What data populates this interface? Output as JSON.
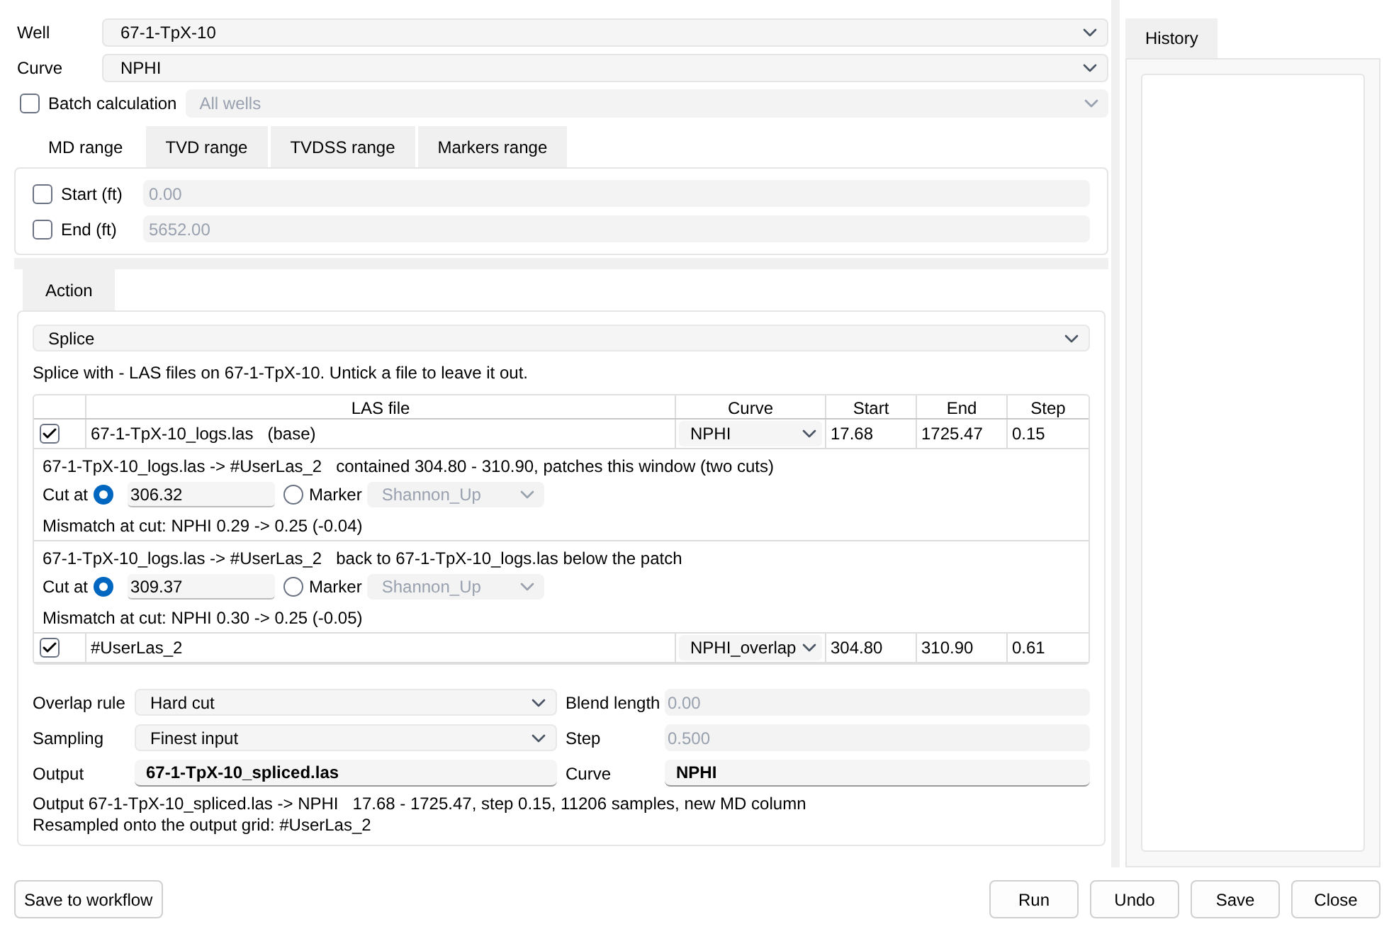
{
  "well": {
    "label": "Well",
    "value": "67-1-TpX-10"
  },
  "curve": {
    "label": "Curve",
    "value": "NPHI"
  },
  "batch": {
    "label": "Batch calculation",
    "checked": false,
    "value": "All wells"
  },
  "range_tabs": [
    {
      "label": "MD range",
      "selected": true
    },
    {
      "label": "TVD range",
      "selected": false
    },
    {
      "label": "TVDSS range",
      "selected": false
    },
    {
      "label": "Markers range",
      "selected": false
    }
  ],
  "range_fields": [
    {
      "label": "Start (ft)",
      "checked": false,
      "value": "0.00"
    },
    {
      "label": "End (ft)",
      "checked": false,
      "value": "5652.00"
    }
  ],
  "action_tab": {
    "label": "Action",
    "selected": true
  },
  "action": {
    "value": "Splice"
  },
  "info": "Splice with - LAS files on 67-1-TpX-10. Untick a file to leave it out.",
  "table": {
    "columns": [
      "LAS file",
      "Curve",
      "Start",
      "End",
      "Step"
    ],
    "rows": [
      {
        "kind": "file",
        "checked": true,
        "file": "67-1-TpX-10_logs.las   (base)",
        "curve": "NPHI",
        "start": "17.68",
        "end": "1725.47",
        "step": "0.15"
      },
      {
        "kind": "cut",
        "description": "67-1-TpX-10_logs.las -> #UserLas_2   contained 304.80 - 310.90, patches this window (two cuts)",
        "cut_label": "Cut at",
        "md_selected": true,
        "md_value": "306.32",
        "marker_selected": false,
        "marker_label": "Marker",
        "marker_value": "Shannon_Up",
        "mismatch": "Mismatch at cut: NPHI 0.29 -> 0.25 (-0.04)"
      },
      {
        "kind": "cut",
        "description": "67-1-TpX-10_logs.las -> #UserLas_2   back to 67-1-TpX-10_logs.las below the patch",
        "cut_label": "Cut at",
        "md_selected": true,
        "md_value": "309.37",
        "marker_selected": false,
        "marker_label": "Marker",
        "marker_value": "Shannon_Up",
        "mismatch": "Mismatch at cut: NPHI 0.30 -> 0.25 (-0.05)"
      },
      {
        "kind": "file",
        "checked": true,
        "file": "#UserLas_2",
        "curve": "NPHI_overlap",
        "start": "304.80",
        "end": "310.90",
        "step": "0.61"
      }
    ]
  },
  "settings": [
    {
      "label": "Overlap rule",
      "kind": "select",
      "value": "Hard cut",
      "side_label": "Blend length",
      "side_value": "0.00"
    },
    {
      "label": "Sampling",
      "kind": "select",
      "value": "Finest input",
      "side_label": "Step",
      "side_value": "0.500"
    },
    {
      "label": "Output",
      "kind": "text",
      "value": "67-1-TpX-10_spliced.las",
      "side_label": "Curve",
      "side_value": "NPHI"
    }
  ],
  "summary": [
    "Output 67-1-TpX-10_spliced.las -> NPHI   17.68 - 1725.47, step 0.15, 11206 samples, new MD column",
    "Resampled onto the output grid: #UserLas_2"
  ],
  "left_buttons": [
    "Save to workflow"
  ],
  "right_buttons": [
    "Run",
    "Undo",
    "Save",
    "Close"
  ],
  "history_tab": {
    "label": "History",
    "selected": true
  }
}
